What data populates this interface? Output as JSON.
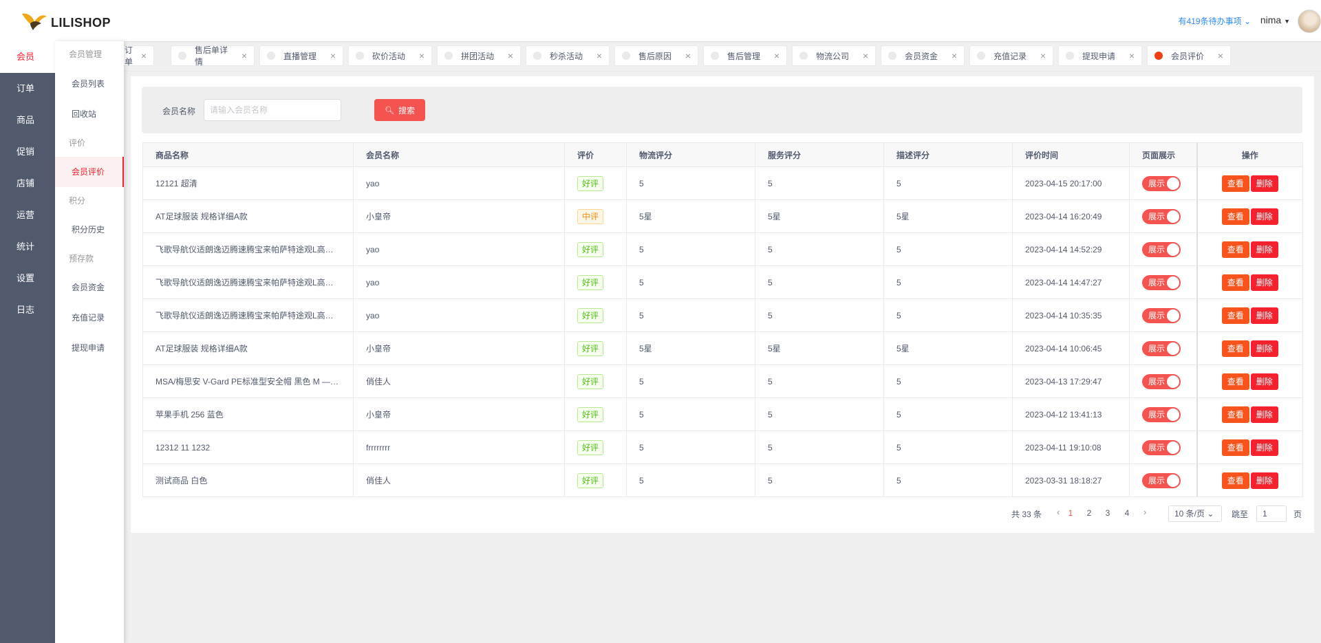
{
  "brand": {
    "logo_text": "LILISHOP"
  },
  "rail": {
    "items": [
      {
        "label": "会员",
        "active": true
      },
      {
        "label": "订单"
      },
      {
        "label": "商品"
      },
      {
        "label": "促销"
      },
      {
        "label": "店铺"
      },
      {
        "label": "运营"
      },
      {
        "label": "统计"
      },
      {
        "label": "设置"
      },
      {
        "label": "日志"
      }
    ]
  },
  "subnav": {
    "group_member": "会员管理",
    "item_member_list": "会员列表",
    "item_recycle": "回收站",
    "group_eval": "评价",
    "item_member_eval": "会员评价",
    "group_points": "积分",
    "item_points_history": "积分历史",
    "group_deposit": "预存款",
    "item_member_funds": "会员资金",
    "item_recharge": "充值记录",
    "item_withdraw": "提现申请"
  },
  "header": {
    "todo": "有419条待办事项",
    "user": "nima"
  },
  "tags": [
    {
      "label": "订单"
    },
    {
      "label": "售后单详情"
    },
    {
      "label": "直播管理"
    },
    {
      "label": "砍价活动"
    },
    {
      "label": "拼团活动"
    },
    {
      "label": "秒杀活动"
    },
    {
      "label": "售后原因"
    },
    {
      "label": "售后管理"
    },
    {
      "label": "物流公司"
    },
    {
      "label": "会员资金"
    },
    {
      "label": "充值记录"
    },
    {
      "label": "提现申请"
    },
    {
      "label": "会员评价",
      "active": true
    }
  ],
  "search": {
    "label": "会员名称",
    "placeholder": "请输入会员名称",
    "button": "搜索"
  },
  "table": {
    "columns": [
      "商品名称",
      "会员名称",
      "评价",
      "物流评分",
      "服务评分",
      "描述评分",
      "评价时间",
      "页面展示",
      "操作"
    ],
    "rows": [
      {
        "goods": "12121 超清",
        "member": "yao",
        "eval": "好评",
        "logistics": "5",
        "service": "5",
        "desc": "5",
        "time": "2023-04-15 20:17:00"
      },
      {
        "goods": "AT足球服装 规格详细A款",
        "member": "小皇帝",
        "eval": "中评",
        "logistics": "5星",
        "service": "5星",
        "desc": "5星",
        "time": "2023-04-14 16:20:49"
      },
      {
        "goods": "飞歌导航仪适朗逸迈腾速腾宝来帕萨特途观L高…",
        "member": "yao",
        "eval": "好评",
        "logistics": "5",
        "service": "5",
        "desc": "5",
        "time": "2023-04-14 14:52:29"
      },
      {
        "goods": "飞歌导航仪适朗逸迈腾速腾宝来帕萨特途观L高…",
        "member": "yao",
        "eval": "好评",
        "logistics": "5",
        "service": "5",
        "desc": "5",
        "time": "2023-04-14 14:47:27"
      },
      {
        "goods": "飞歌导航仪适朗逸迈腾速腾宝来帕萨特途观L高…",
        "member": "yao",
        "eval": "好评",
        "logistics": "5",
        "service": "5",
        "desc": "5",
        "time": "2023-04-14 10:35:35"
      },
      {
        "goods": "AT足球服装 规格详细A款",
        "member": "小皇帝",
        "eval": "好评",
        "logistics": "5星",
        "service": "5星",
        "desc": "5星",
        "time": "2023-04-14 10:06:45"
      },
      {
        "goods": "MSA/梅思安 V-Gard PE标准型安全帽 黑色 M —…",
        "member": "俏佳人",
        "eval": "好评",
        "logistics": "5",
        "service": "5",
        "desc": "5",
        "time": "2023-04-13 17:29:47"
      },
      {
        "goods": "苹果手机 256 蓝色",
        "member": "小皇帝",
        "eval": "好评",
        "logistics": "5",
        "service": "5",
        "desc": "5",
        "time": "2023-04-12 13:41:13"
      },
      {
        "goods": "12312 11 1232",
        "member": "frrrrrrrr",
        "eval": "好评",
        "logistics": "5",
        "service": "5",
        "desc": "5",
        "time": "2023-04-11 19:10:08"
      },
      {
        "goods": "测试商品 白色",
        "member": "俏佳人",
        "eval": "好评",
        "logistics": "5",
        "service": "5",
        "desc": "5",
        "time": "2023-03-31 18:18:27"
      }
    ],
    "switch_label": "展示",
    "view_label": "查看",
    "delete_label": "删除"
  },
  "pagination": {
    "total": "共 33 条",
    "pages": [
      "1",
      "2",
      "3",
      "4"
    ],
    "current": "1",
    "page_size": "10 条/页",
    "jump_label": "跳至",
    "jump_value": "1",
    "page_suffix": "页"
  },
  "colors": {
    "accent": "#f5534f",
    "rail": "#505a6c",
    "good": "#52c41a",
    "mid": "#fa8c16",
    "view_btn": "#fa541c",
    "delete_btn": "#f5222d"
  }
}
